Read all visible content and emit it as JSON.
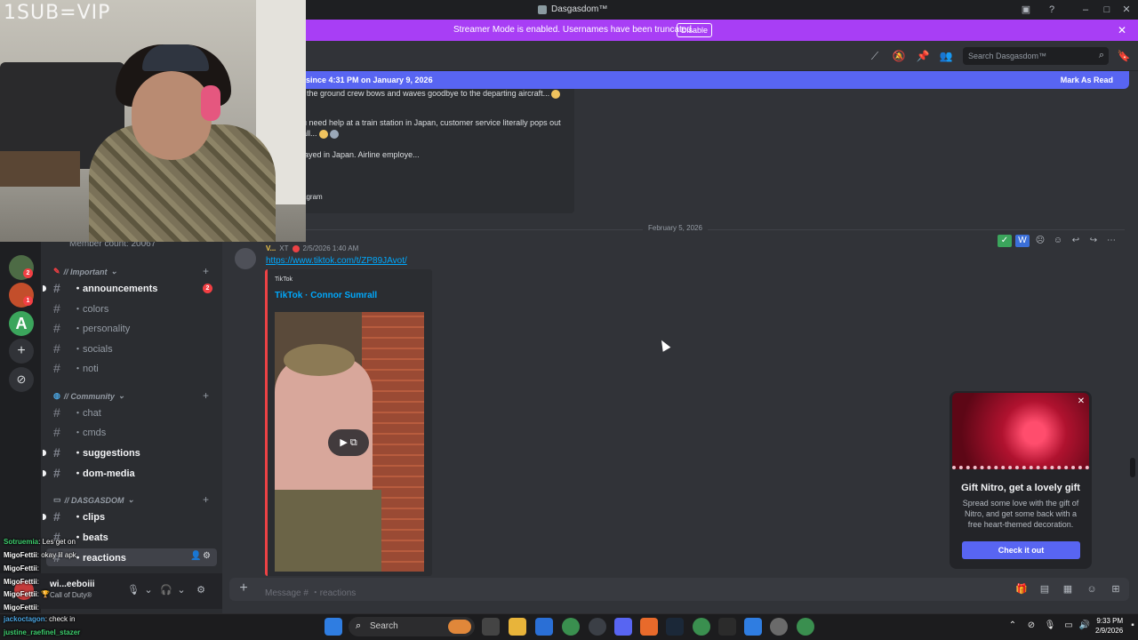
{
  "window": {
    "title": "Dasgasdom™"
  },
  "streamer_banner": {
    "text": "Streamer Mode is enabled. Usernames have been truncated.",
    "disable_label": "Disable"
  },
  "search": {
    "placeholder": "Search Dasgasdom™"
  },
  "new_messages": {
    "text": "since 4:31 PM on January 9, 2026",
    "mark_label": "Mark As Read"
  },
  "old_embed": {
    "lines": [
      ", the ground crew bows and waves goodbye to the departing aircraft...",
      "u need help at a train station in Japan, customer service literally pops out",
      "all...",
      "layed in Japan. Airline employe...",
      "agram"
    ]
  },
  "divider": {
    "date": "February 5, 2026"
  },
  "message": {
    "user": "V...",
    "tag": "XT",
    "timestamp": "2/5/2026 1:40 AM",
    "link": "https://www.tiktok.com/t/ZP89JAvot/",
    "embed_provider": "TikTok",
    "embed_title": "TikTok · Connor Sumrall"
  },
  "nitro": {
    "heading": "Gift Nitro, get a lovely gift",
    "body": "Spread some love with the gift of Nitro, and get some back with a free heart-themed decoration.",
    "cta": "Check it out"
  },
  "composer": {
    "placeholder": "Message # ・reactions"
  },
  "sidebar": {
    "member_count": "Member count: 20067",
    "categories": [
      {
        "label": "// Important"
      },
      {
        "label": "// Community"
      },
      {
        "label": "// DASGASDOM"
      }
    ],
    "channels": [
      {
        "label": "・announcements",
        "badge": "2"
      },
      {
        "label": "・colors"
      },
      {
        "label": "・personality"
      },
      {
        "label": "・socials"
      },
      {
        "label": "・noti"
      },
      {
        "label": "・chat"
      },
      {
        "label": "・cmds"
      },
      {
        "label": "・suggestions"
      },
      {
        "label": "・dom-media"
      },
      {
        "label": "・clips"
      },
      {
        "label": "・beats"
      },
      {
        "label": "・reactions"
      }
    ],
    "server_badges": [
      "2",
      "1"
    ]
  },
  "user_panel": {
    "name": "wi...eeboiii",
    "status": "Call of Duty®"
  },
  "webcam": {
    "overlay_text": "1SUB=VIP"
  },
  "chat_overlay": [
    {
      "user": "Sotruemia",
      "text": ": Les get on"
    },
    {
      "user": "MigoFettii",
      "text": ": okay lil apk"
    },
    {
      "user": "MigoFettii",
      "text": ":"
    },
    {
      "user": "MigoFettii",
      "text": ":"
    },
    {
      "user": "MigoFettii",
      "text": ": 🏆"
    },
    {
      "user": "MigoFettii",
      "text": ":"
    },
    {
      "user": "jackoctagon",
      "text": ": check in"
    },
    {
      "user": "justine_raefinel_stazer",
      "text": ""
    }
  ],
  "taskbar": {
    "search_label": "Search",
    "time": "9:33 PM",
    "date": "2/9/2026"
  },
  "colors": {
    "accent": "#5865f2",
    "streamer": "#a83ef5",
    "danger": "#f23f43",
    "link": "#00a8fc"
  }
}
